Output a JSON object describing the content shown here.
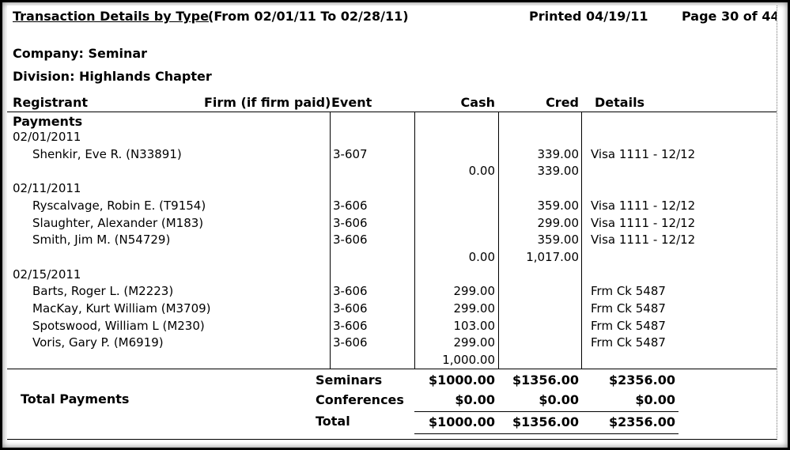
{
  "header": {
    "title": "Transaction Details by Type",
    "range": "(From 02/01/11 To 02/28/11)",
    "printed": "Printed 04/19/11",
    "page": "Page 30 of 44"
  },
  "company": "Company: Seminar",
  "division": "Division: Highlands Chapter",
  "columns": {
    "registrant": "Registrant",
    "firm": "Firm (if firm paid)",
    "event": "Event",
    "cash": "Cash",
    "cred": "Cred",
    "details": "Details"
  },
  "section": "Payments",
  "groups": [
    {
      "date": "02/01/2011",
      "rows": [
        {
          "name": "Shenkir, Eve R. (N33891)",
          "event": "3-607",
          "cash": "",
          "cred": "339.00",
          "details": "Visa 1111 - 12/12"
        }
      ],
      "subtotal": {
        "cash": "0.00",
        "cred": "339.00"
      }
    },
    {
      "date": "02/11/2011",
      "rows": [
        {
          "name": "Ryscalvage, Robin E. (T9154)",
          "event": "3-606",
          "cash": "",
          "cred": "359.00",
          "details": "Visa 1111 - 12/12"
        },
        {
          "name": "Slaughter, Alexander (M183)",
          "event": "3-606",
          "cash": "",
          "cred": "299.00",
          "details": "Visa 1111 - 12/12"
        },
        {
          "name": "Smith, Jim M. (N54729)",
          "event": "3-606",
          "cash": "",
          "cred": "359.00",
          "details": "Visa 1111 - 12/12"
        }
      ],
      "subtotal": {
        "cash": "0.00",
        "cred": "1,017.00"
      }
    },
    {
      "date": "02/15/2011",
      "rows": [
        {
          "name": "Barts, Roger L. (M2223)",
          "event": "3-606",
          "cash": "299.00",
          "cred": "",
          "details": "Frm Ck 5487"
        },
        {
          "name": "MacKay, Kurt William (M3709)",
          "event": "3-606",
          "cash": "299.00",
          "cred": "",
          "details": "Frm Ck 5487"
        },
        {
          "name": "Spotswood, William L (M230)",
          "event": "3-606",
          "cash": "103.00",
          "cred": "",
          "details": "Frm Ck 5487"
        },
        {
          "name": "Voris, Gary P. (M6919)",
          "event": "3-606",
          "cash": "299.00",
          "cred": "",
          "details": "Frm Ck 5487"
        }
      ],
      "subtotal": {
        "cash": "1,000.00",
        "cred": ""
      }
    }
  ],
  "totals": {
    "label": "Total Payments",
    "rows": [
      {
        "label": "Seminars",
        "cash": "$1000.00",
        "cred": "$1356.00",
        "total": "$2356.00"
      },
      {
        "label": "Conferences",
        "cash": "$0.00",
        "cred": "$0.00",
        "total": "$0.00"
      },
      {
        "label": "Total",
        "cash": "$1000.00",
        "cred": "$1356.00",
        "total": "$2356.00"
      }
    ]
  }
}
